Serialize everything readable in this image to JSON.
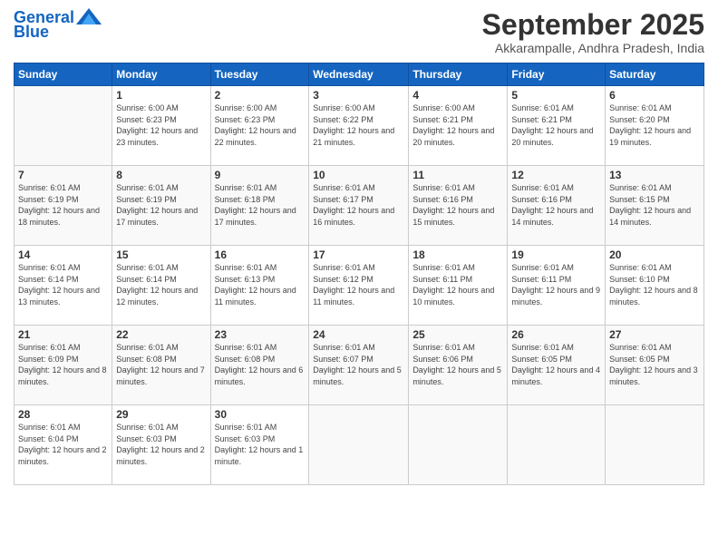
{
  "logo": {
    "line1": "General",
    "line2": "Blue"
  },
  "header": {
    "title": "September 2025",
    "location": "Akkarampalle, Andhra Pradesh, India"
  },
  "weekdays": [
    "Sunday",
    "Monday",
    "Tuesday",
    "Wednesday",
    "Thursday",
    "Friday",
    "Saturday"
  ],
  "weeks": [
    [
      {
        "day": "",
        "sunrise": "",
        "sunset": "",
        "daylight": ""
      },
      {
        "day": "1",
        "sunrise": "Sunrise: 6:00 AM",
        "sunset": "Sunset: 6:23 PM",
        "daylight": "Daylight: 12 hours and 23 minutes."
      },
      {
        "day": "2",
        "sunrise": "Sunrise: 6:00 AM",
        "sunset": "Sunset: 6:23 PM",
        "daylight": "Daylight: 12 hours and 22 minutes."
      },
      {
        "day": "3",
        "sunrise": "Sunrise: 6:00 AM",
        "sunset": "Sunset: 6:22 PM",
        "daylight": "Daylight: 12 hours and 21 minutes."
      },
      {
        "day": "4",
        "sunrise": "Sunrise: 6:00 AM",
        "sunset": "Sunset: 6:21 PM",
        "daylight": "Daylight: 12 hours and 20 minutes."
      },
      {
        "day": "5",
        "sunrise": "Sunrise: 6:01 AM",
        "sunset": "Sunset: 6:21 PM",
        "daylight": "Daylight: 12 hours and 20 minutes."
      },
      {
        "day": "6",
        "sunrise": "Sunrise: 6:01 AM",
        "sunset": "Sunset: 6:20 PM",
        "daylight": "Daylight: 12 hours and 19 minutes."
      }
    ],
    [
      {
        "day": "7",
        "sunrise": "Sunrise: 6:01 AM",
        "sunset": "Sunset: 6:19 PM",
        "daylight": "Daylight: 12 hours and 18 minutes."
      },
      {
        "day": "8",
        "sunrise": "Sunrise: 6:01 AM",
        "sunset": "Sunset: 6:19 PM",
        "daylight": "Daylight: 12 hours and 17 minutes."
      },
      {
        "day": "9",
        "sunrise": "Sunrise: 6:01 AM",
        "sunset": "Sunset: 6:18 PM",
        "daylight": "Daylight: 12 hours and 17 minutes."
      },
      {
        "day": "10",
        "sunrise": "Sunrise: 6:01 AM",
        "sunset": "Sunset: 6:17 PM",
        "daylight": "Daylight: 12 hours and 16 minutes."
      },
      {
        "day": "11",
        "sunrise": "Sunrise: 6:01 AM",
        "sunset": "Sunset: 6:16 PM",
        "daylight": "Daylight: 12 hours and 15 minutes."
      },
      {
        "day": "12",
        "sunrise": "Sunrise: 6:01 AM",
        "sunset": "Sunset: 6:16 PM",
        "daylight": "Daylight: 12 hours and 14 minutes."
      },
      {
        "day": "13",
        "sunrise": "Sunrise: 6:01 AM",
        "sunset": "Sunset: 6:15 PM",
        "daylight": "Daylight: 12 hours and 14 minutes."
      }
    ],
    [
      {
        "day": "14",
        "sunrise": "Sunrise: 6:01 AM",
        "sunset": "Sunset: 6:14 PM",
        "daylight": "Daylight: 12 hours and 13 minutes."
      },
      {
        "day": "15",
        "sunrise": "Sunrise: 6:01 AM",
        "sunset": "Sunset: 6:14 PM",
        "daylight": "Daylight: 12 hours and 12 minutes."
      },
      {
        "day": "16",
        "sunrise": "Sunrise: 6:01 AM",
        "sunset": "Sunset: 6:13 PM",
        "daylight": "Daylight: 12 hours and 11 minutes."
      },
      {
        "day": "17",
        "sunrise": "Sunrise: 6:01 AM",
        "sunset": "Sunset: 6:12 PM",
        "daylight": "Daylight: 12 hours and 11 minutes."
      },
      {
        "day": "18",
        "sunrise": "Sunrise: 6:01 AM",
        "sunset": "Sunset: 6:11 PM",
        "daylight": "Daylight: 12 hours and 10 minutes."
      },
      {
        "day": "19",
        "sunrise": "Sunrise: 6:01 AM",
        "sunset": "Sunset: 6:11 PM",
        "daylight": "Daylight: 12 hours and 9 minutes."
      },
      {
        "day": "20",
        "sunrise": "Sunrise: 6:01 AM",
        "sunset": "Sunset: 6:10 PM",
        "daylight": "Daylight: 12 hours and 8 minutes."
      }
    ],
    [
      {
        "day": "21",
        "sunrise": "Sunrise: 6:01 AM",
        "sunset": "Sunset: 6:09 PM",
        "daylight": "Daylight: 12 hours and 8 minutes."
      },
      {
        "day": "22",
        "sunrise": "Sunrise: 6:01 AM",
        "sunset": "Sunset: 6:08 PM",
        "daylight": "Daylight: 12 hours and 7 minutes."
      },
      {
        "day": "23",
        "sunrise": "Sunrise: 6:01 AM",
        "sunset": "Sunset: 6:08 PM",
        "daylight": "Daylight: 12 hours and 6 minutes."
      },
      {
        "day": "24",
        "sunrise": "Sunrise: 6:01 AM",
        "sunset": "Sunset: 6:07 PM",
        "daylight": "Daylight: 12 hours and 5 minutes."
      },
      {
        "day": "25",
        "sunrise": "Sunrise: 6:01 AM",
        "sunset": "Sunset: 6:06 PM",
        "daylight": "Daylight: 12 hours and 5 minutes."
      },
      {
        "day": "26",
        "sunrise": "Sunrise: 6:01 AM",
        "sunset": "Sunset: 6:05 PM",
        "daylight": "Daylight: 12 hours and 4 minutes."
      },
      {
        "day": "27",
        "sunrise": "Sunrise: 6:01 AM",
        "sunset": "Sunset: 6:05 PM",
        "daylight": "Daylight: 12 hours and 3 minutes."
      }
    ],
    [
      {
        "day": "28",
        "sunrise": "Sunrise: 6:01 AM",
        "sunset": "Sunset: 6:04 PM",
        "daylight": "Daylight: 12 hours and 2 minutes."
      },
      {
        "day": "29",
        "sunrise": "Sunrise: 6:01 AM",
        "sunset": "Sunset: 6:03 PM",
        "daylight": "Daylight: 12 hours and 2 minutes."
      },
      {
        "day": "30",
        "sunrise": "Sunrise: 6:01 AM",
        "sunset": "Sunset: 6:03 PM",
        "daylight": "Daylight: 12 hours and 1 minute."
      },
      {
        "day": "",
        "sunrise": "",
        "sunset": "",
        "daylight": ""
      },
      {
        "day": "",
        "sunrise": "",
        "sunset": "",
        "daylight": ""
      },
      {
        "day": "",
        "sunrise": "",
        "sunset": "",
        "daylight": ""
      },
      {
        "day": "",
        "sunrise": "",
        "sunset": "",
        "daylight": ""
      }
    ]
  ]
}
